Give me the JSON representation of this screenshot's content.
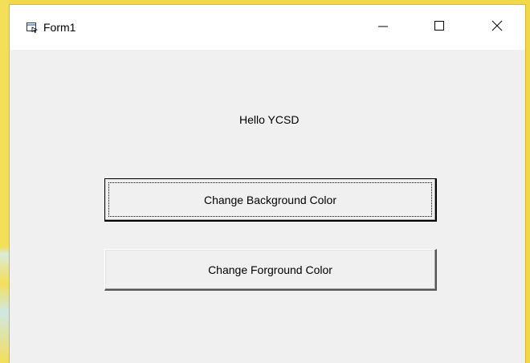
{
  "window": {
    "title": "Form1",
    "icon": "form-icon",
    "controls": {
      "minimize": "minimize-icon",
      "maximize": "maximize-icon",
      "close": "close-icon"
    }
  },
  "form": {
    "label_text": "Hello YCSD",
    "buttons": [
      {
        "label": "Change Background Color",
        "focused": true
      },
      {
        "label": "Change Forground Color",
        "focused": false
      }
    ]
  },
  "colors": {
    "client_background": "#f0f0f0",
    "titlebar_background": "#ffffff",
    "desktop_background": "#f0d84a"
  }
}
